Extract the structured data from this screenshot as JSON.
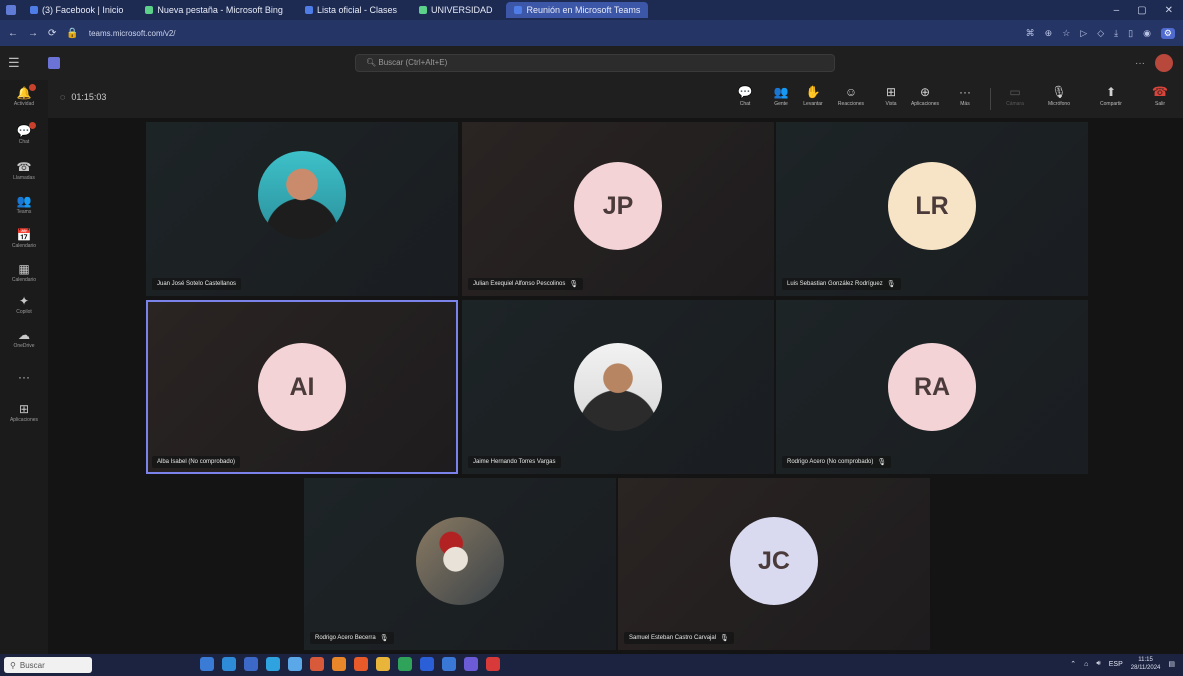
{
  "browser": {
    "tabs": [
      "(3) Facebook | Inicio",
      "Nueva pestaña - Microsoft Bing",
      "Lista oficial - Clases",
      "UNIVERSIDAD",
      "Reunión en Microsoft Teams"
    ],
    "url": "teams.microsoft.com/v2/",
    "window_controls": [
      "–",
      "▢",
      "✕"
    ]
  },
  "teams": {
    "search_placeholder": "Buscar (Ctrl+Alt+E)",
    "more_label": "···"
  },
  "rail": [
    {
      "icon": "bell-icon",
      "label": "Actividad",
      "glyph": "🔔"
    },
    {
      "icon": "chat-icon",
      "label": "Chat",
      "glyph": "💬"
    },
    {
      "icon": "phone-icon",
      "label": "Llamadas",
      "glyph": "☎"
    },
    {
      "icon": "teams-icon",
      "label": "Teams",
      "glyph": "👥"
    },
    {
      "icon": "calendar-icon",
      "label": "Calendario",
      "glyph": "📅"
    },
    {
      "icon": "calendar-grid-icon",
      "label": "Calendario",
      "glyph": "▦"
    },
    {
      "icon": "copilot-icon",
      "label": "Copilot",
      "glyph": "✦"
    },
    {
      "icon": "onedrive-icon",
      "label": "OneDrive",
      "glyph": "☁"
    },
    {
      "icon": "more-icon",
      "label": "",
      "glyph": "···"
    },
    {
      "icon": "apps-icon",
      "label": "Aplicaciones",
      "glyph": "⊞"
    }
  ],
  "meeting": {
    "timer": "01:15:03",
    "controls": [
      {
        "name": "chat",
        "label": "Chat",
        "glyph": "💬"
      },
      {
        "name": "people",
        "label": "Gente",
        "glyph": "👥"
      },
      {
        "name": "raise-hand",
        "label": "Levantar",
        "glyph": "✋"
      },
      {
        "name": "react",
        "label": "Reacciones",
        "glyph": "☺"
      },
      {
        "name": "view",
        "label": "Vista",
        "glyph": "⊞"
      },
      {
        "name": "apps",
        "label": "Aplicaciones",
        "glyph": "⊕"
      },
      {
        "name": "more",
        "label": "Más",
        "glyph": "···"
      }
    ],
    "camera_label": "Cámara",
    "mic_label": "Micrófono",
    "share_label": "Compartir",
    "leave_label": "Salir"
  },
  "participants": [
    {
      "name": "Juan José Sotelo Castellanos",
      "type": "photo",
      "muted": false
    },
    {
      "name": "Julian Exequiel Alfonso Pescolinos",
      "initials": "JP",
      "type": "initials",
      "color": "#f3d3d6",
      "muted": true
    },
    {
      "name": "Luis Sebastian González Rodríguez",
      "initials": "LR",
      "type": "initials",
      "color": "#f7e3c6",
      "muted": true
    },
    {
      "name": "Alba Isabel (No comprobado)",
      "initials": "AI",
      "type": "initials",
      "color": "#f3d3d6",
      "muted": false
    },
    {
      "name": "Jaime Hernando Torres Vargas",
      "type": "photo",
      "muted": false
    },
    {
      "name": "Rodrigo Acero (No comprobado)",
      "initials": "RA",
      "type": "initials",
      "color": "#f3d3d6",
      "muted": true
    },
    {
      "name": "Rodrigo Acero Becerra",
      "type": "photo",
      "muted": true
    },
    {
      "name": "Samuel Esteban Castro Carvajal",
      "initials": "JC",
      "type": "initials",
      "color": "#d9daf0",
      "muted": true
    }
  ],
  "taskbar": {
    "search_label": "Buscar",
    "tray_lang": "ESP",
    "time": "11:15",
    "date": "28/11/2024"
  },
  "colors": {
    "accent": "#7b83eb",
    "leave": "#d9443a"
  }
}
